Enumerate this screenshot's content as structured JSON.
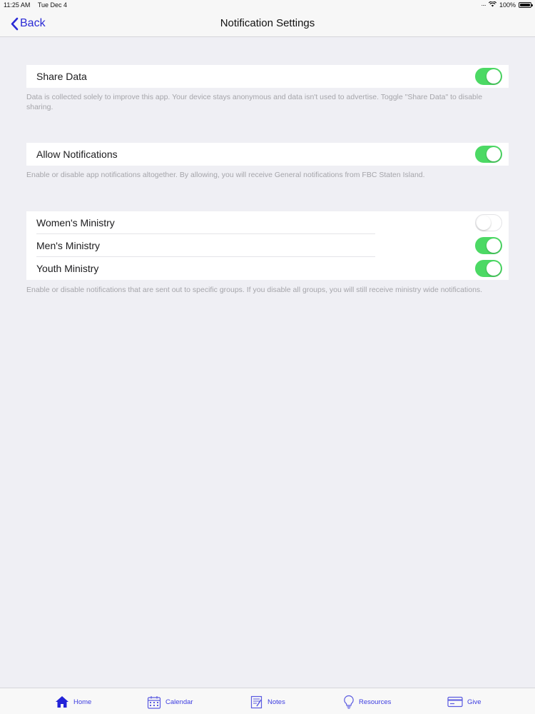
{
  "status_bar": {
    "time": "11:25 AM",
    "date": "Tue Dec 4",
    "battery": "100%",
    "icons": [
      "signal-dots-icon",
      "wifi-icon",
      "battery-icon"
    ]
  },
  "nav": {
    "back_label": "Back",
    "title": "Notification Settings"
  },
  "sections": {
    "share": {
      "label": "Share Data",
      "enabled": true,
      "footer": "Data is collected solely to improve this app. Your device stays anonymous and data isn't used to advertise. Toggle \"Share Data\" to disable sharing."
    },
    "notifications": {
      "label": "Allow Notifications",
      "enabled": true,
      "footer": "Enable or disable app notifications altogether. By allowing, you will receive General notifications from FBC Staten Island."
    },
    "groups": {
      "items": [
        {
          "label": "Women's Ministry",
          "enabled": false
        },
        {
          "label": "Men's Ministry",
          "enabled": true
        },
        {
          "label": "Youth Ministry",
          "enabled": true
        }
      ],
      "footer": "Enable or disable notifications that are sent out to specific groups. If you disable all groups, you will still receive ministry wide notifications."
    }
  },
  "tab_bar": {
    "tabs": [
      {
        "label": "Home",
        "icon": "home-icon"
      },
      {
        "label": "Calendar",
        "icon": "calendar-icon"
      },
      {
        "label": "Notes",
        "icon": "notes-icon"
      },
      {
        "label": "Resources",
        "icon": "lightbulb-icon"
      },
      {
        "label": "Give",
        "icon": "credit-card-icon"
      }
    ]
  },
  "colors": {
    "accent": "#3d3de0",
    "toggle_on": "#4cd964",
    "background": "#efeff4"
  }
}
